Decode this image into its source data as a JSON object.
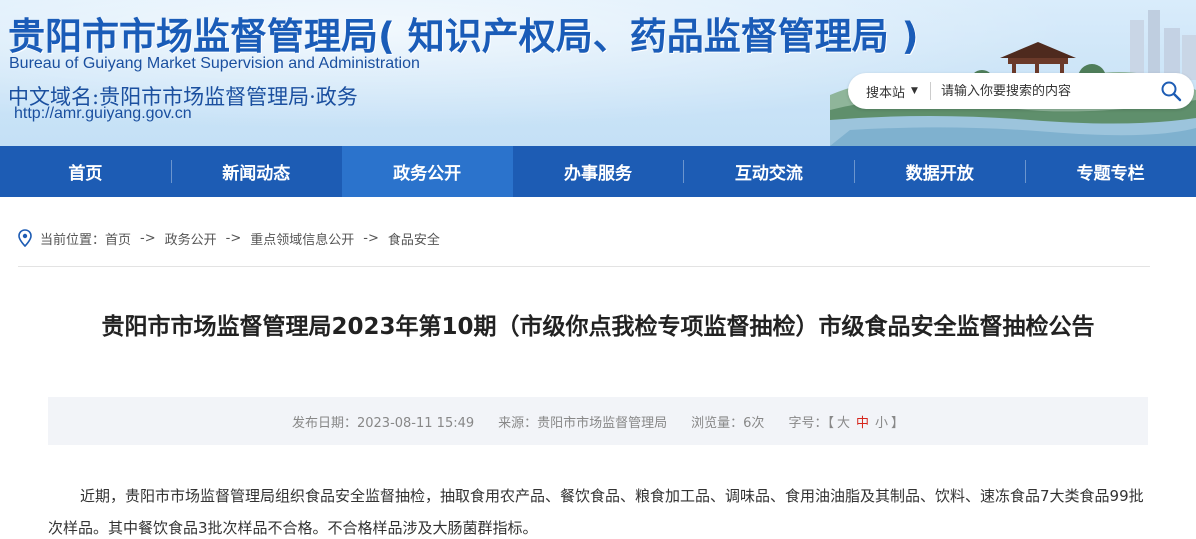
{
  "header": {
    "title": "贵阳市市场监督管理局( 知识产权局、药品监督管理局 )",
    "title_en": "Bureau of Guiyang Market Supervision and Administration",
    "domain_cn": "中文域名:贵阳市市场监督管理局·政务",
    "url": "http://amr.guiyang.gov.cn"
  },
  "search": {
    "scope": "搜本站",
    "placeholder": "请输入你要搜索的内容",
    "icon": "search-icon"
  },
  "nav": {
    "items": [
      {
        "label": "首页"
      },
      {
        "label": "新闻动态"
      },
      {
        "label": "政务公开",
        "active": true
      },
      {
        "label": "办事服务"
      },
      {
        "label": "互动交流"
      },
      {
        "label": "数据开放"
      },
      {
        "label": "专题专栏"
      }
    ]
  },
  "breadcrumb": {
    "prefix": "当前位置：",
    "separator": "->",
    "items": [
      "首页",
      "政务公开",
      "重点领域信息公开",
      "食品安全"
    ]
  },
  "article": {
    "title": "贵阳市市场监督管理局2023年第10期（市级你点我检专项监督抽检）市级食品安全监督抽检公告",
    "meta": {
      "date": "发布日期：2023-08-11 15:49",
      "source": "来源：贵阳市市场监督管理局",
      "views": "浏览量：6次",
      "font_label": "字号：【",
      "font_large": "大",
      "font_medium": "中",
      "font_small": "小",
      "font_close": "】"
    },
    "body": "近期，贵阳市市场监督管理局组织食品安全监督抽检，抽取食用农产品、餐饮食品、粮食加工品、调味品、食用油油脂及其制品、饮料、速冻食品7大类食品99批次样品。其中餐饮食品3批次样品不合格。不合格样品涉及大肠菌群指标。"
  },
  "colors": {
    "nav_bg": "#1d5cb4",
    "nav_active": "#2b73cc",
    "title_blue": "#1a5cb8",
    "accent_red": "#d6251b"
  }
}
